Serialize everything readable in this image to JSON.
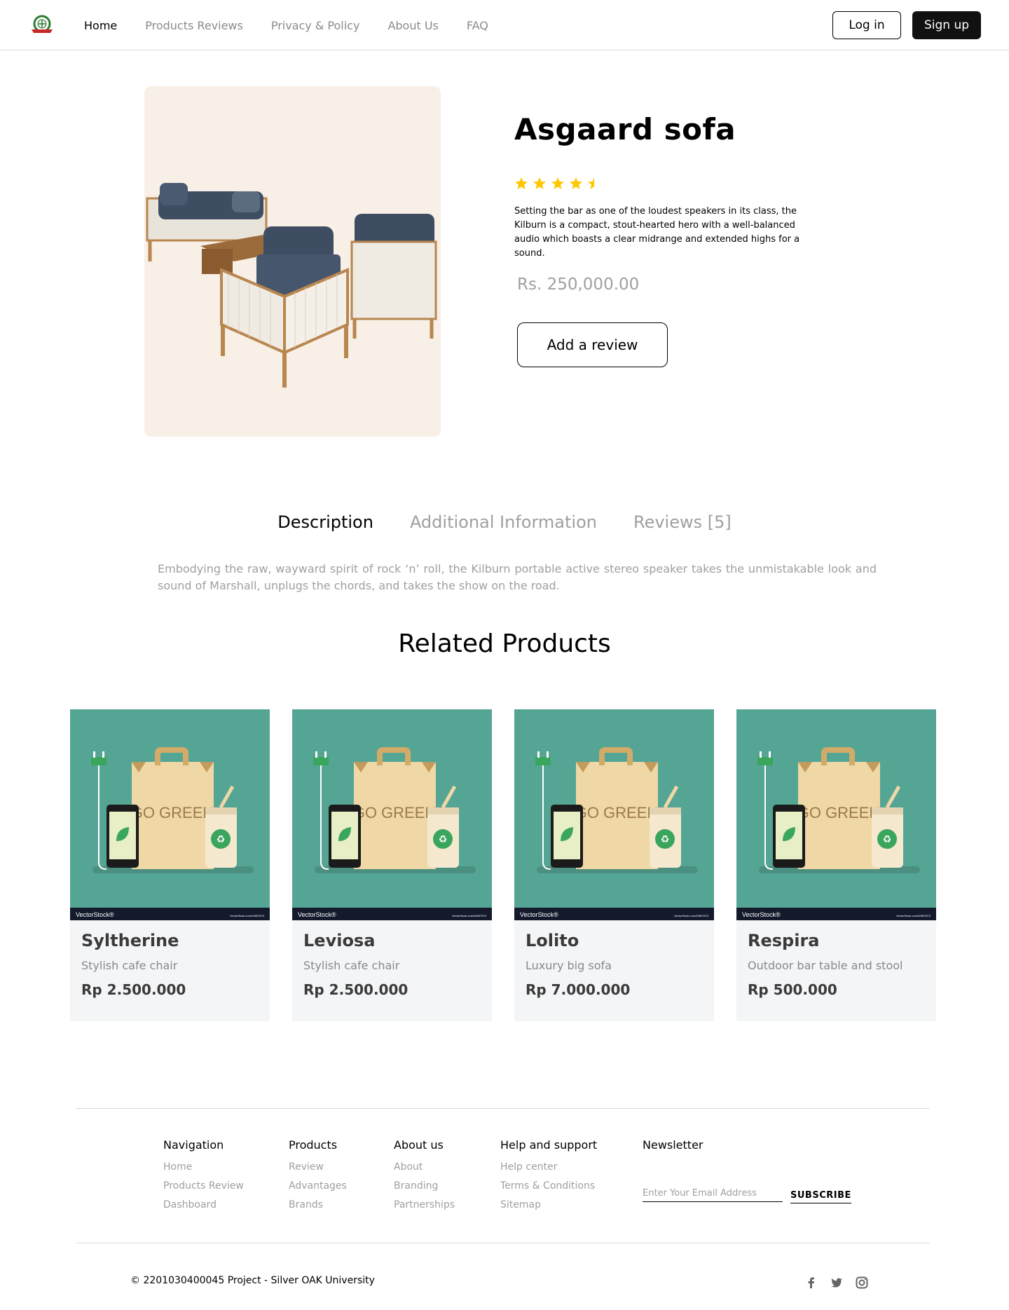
{
  "header": {
    "nav": [
      {
        "label": "Home",
        "active": true
      },
      {
        "label": "Products Reviews",
        "active": false
      },
      {
        "label": "Privacy & Policy",
        "active": false
      },
      {
        "label": "About Us",
        "active": false
      },
      {
        "label": "FAQ",
        "active": false
      }
    ],
    "login_label": "Log in",
    "signup_label": "Sign up"
  },
  "product": {
    "title": "Asgaard sofa",
    "rating": 4.5,
    "rating_max": 5,
    "description": "Setting the bar as one of the loudest speakers in its class, the Kilburn is a compact, stout-hearted hero with a well-balanced audio which boasts a clear midrange and extended highs for a sound.",
    "price": "Rs. 250,000.00",
    "review_button": "Add a review",
    "image_icon": "sofa-image"
  },
  "tabs": {
    "items": [
      "Description",
      "Additional Information",
      "Reviews [5]"
    ],
    "active_index": 0,
    "content": "Embodying the raw, wayward spirit of rock ‘n’ roll, the Kilburn portable active stereo speaker takes the unmistakable look and sound of Marshall, unplugs the chords, and takes the show on the road."
  },
  "related": {
    "title": "Related Products",
    "image_caption": "GO GREEN",
    "image_watermark": "VectorStock®",
    "image_watermark_url": "VectorStock.com/20807673",
    "items": [
      {
        "name": "Syltherine",
        "desc": "Stylish cafe chair",
        "price": "Rp 2.500.000"
      },
      {
        "name": "Leviosa",
        "desc": "Stylish cafe chair",
        "price": "Rp 2.500.000"
      },
      {
        "name": "Lolito",
        "desc": "Luxury big sofa",
        "price": "Rp 7.000.000"
      },
      {
        "name": "Respira",
        "desc": "Outdoor bar table and stool",
        "price": "Rp 500.000"
      }
    ]
  },
  "footer": {
    "columns": [
      {
        "title": "Navigation",
        "links": [
          "Home",
          "Products Review",
          "Dashboard"
        ]
      },
      {
        "title": "Products",
        "links": [
          "Review",
          "Advantages",
          "Brands"
        ]
      },
      {
        "title": "About us",
        "links": [
          "About",
          "Branding",
          "Partnerships"
        ]
      },
      {
        "title": "Help and support",
        "links": [
          "Help center",
          "Terms & Conditions",
          "Sitemap"
        ]
      }
    ],
    "newsletter_title": "Newsletter",
    "newsletter_placeholder": "Enter Your Email Address",
    "subscribe_label": "SUBSCRIBE",
    "copyright": "© 2201030400045 Project - Silver OAK University",
    "socials": [
      "facebook-icon",
      "twitter-icon",
      "instagram-icon"
    ]
  },
  "colors": {
    "accent": "#111111",
    "muted_text": "#9f9f9f",
    "card_bg": "#f4f5f7",
    "hero_bg": "#f8efe6",
    "star": "#ffc700",
    "eco_teal": "#55a595"
  }
}
